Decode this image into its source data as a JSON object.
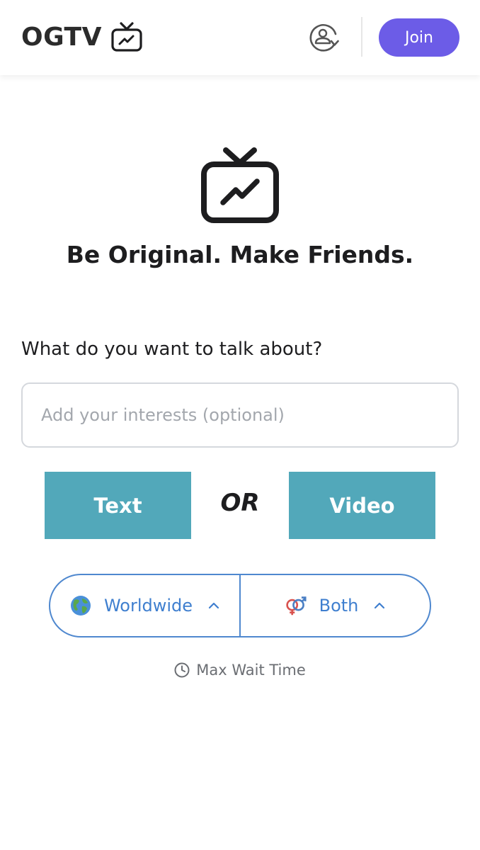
{
  "header": {
    "brand": "OGTV",
    "join_label": "Join",
    "accent_color": "#6c5ce7"
  },
  "hero": {
    "tagline": "Be Original. Make Friends."
  },
  "interests": {
    "question": "What do you want to talk about?",
    "placeholder": "Add your interests (optional)",
    "value": ""
  },
  "modes": {
    "text_label": "Text",
    "or_label": "OR",
    "video_label": "Video",
    "button_color": "#52a8ba"
  },
  "filters": {
    "region": {
      "label": "Worldwide",
      "icon": "globe-icon"
    },
    "gender": {
      "label": "Both",
      "icon": "gender-both-icon"
    },
    "border_color": "#4f88cf"
  },
  "wait": {
    "label": "Max Wait Time",
    "icon": "clock-icon"
  }
}
